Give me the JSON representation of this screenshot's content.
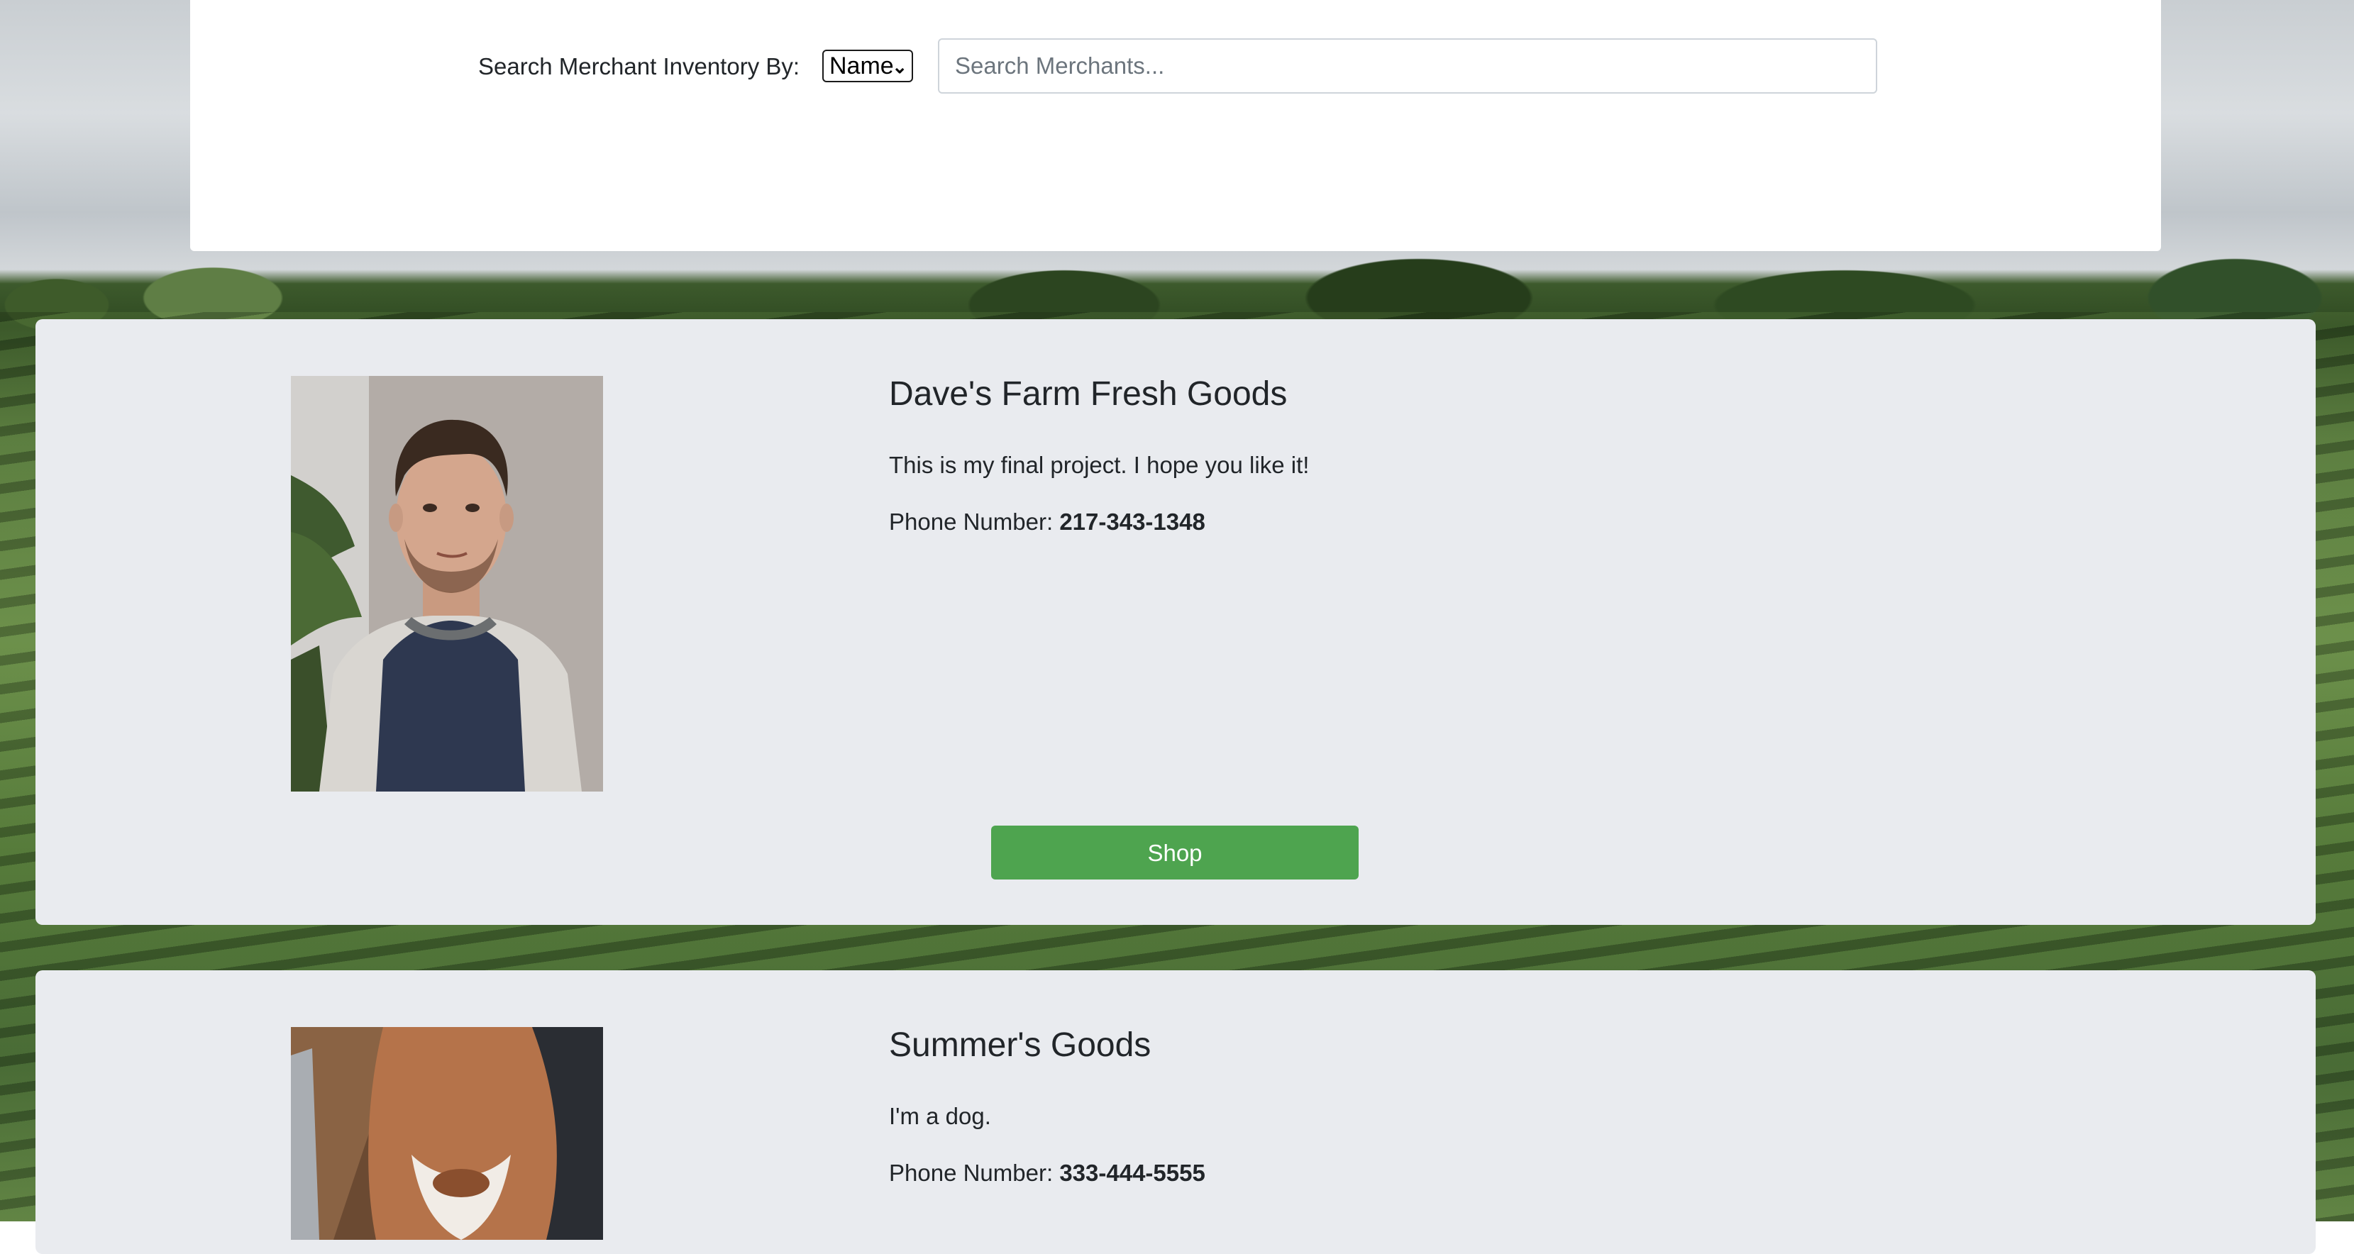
{
  "search": {
    "label": "Search Merchant Inventory By:",
    "select_value": "Name",
    "placeholder": "Search Merchants..."
  },
  "merchants": [
    {
      "name": "Dave's Farm Fresh Goods",
      "description": "This is my final project. I hope you like it!",
      "phone_label": "Phone Number:",
      "phone": "217-343-1348",
      "shop_label": "Shop"
    },
    {
      "name": "Summer's Goods",
      "description": "I'm a dog.",
      "phone_label": "Phone Number:",
      "phone": "333-444-5555"
    }
  ],
  "colors": {
    "shop_button": "#4ea44f",
    "card_background": "#e9ebef",
    "panel_background": "#ffffff"
  }
}
